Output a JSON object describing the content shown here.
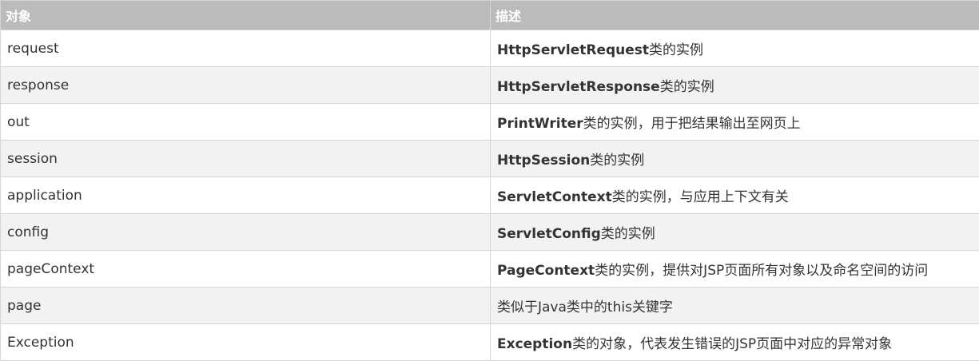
{
  "table": {
    "headers": [
      "对象",
      "描述"
    ],
    "rows": [
      {
        "object": "request",
        "class_bold": "HttpServletRequest",
        "desc": "类的实例"
      },
      {
        "object": "response",
        "class_bold": "HttpServletResponse",
        "desc": "类的实例"
      },
      {
        "object": "out",
        "class_bold": "PrintWriter",
        "desc": "类的实例，用于把结果输出至网页上"
      },
      {
        "object": "session",
        "class_bold": "HttpSession",
        "desc": "类的实例"
      },
      {
        "object": "application",
        "class_bold": "ServletContext",
        "desc": "类的实例，与应用上下文有关"
      },
      {
        "object": "config",
        "class_bold": "ServletConfig",
        "desc": "类的实例"
      },
      {
        "object": "pageContext",
        "class_bold": "PageContext",
        "desc": "类的实例，提供对JSP页面所有对象以及命名空间的访问"
      },
      {
        "object": "page",
        "class_bold": "",
        "desc": "类似于Java类中的this关键字"
      },
      {
        "object": "Exception",
        "class_bold": "Exception",
        "desc": "类的对象，代表发生错误的JSP页面中对应的异常对象"
      }
    ]
  }
}
